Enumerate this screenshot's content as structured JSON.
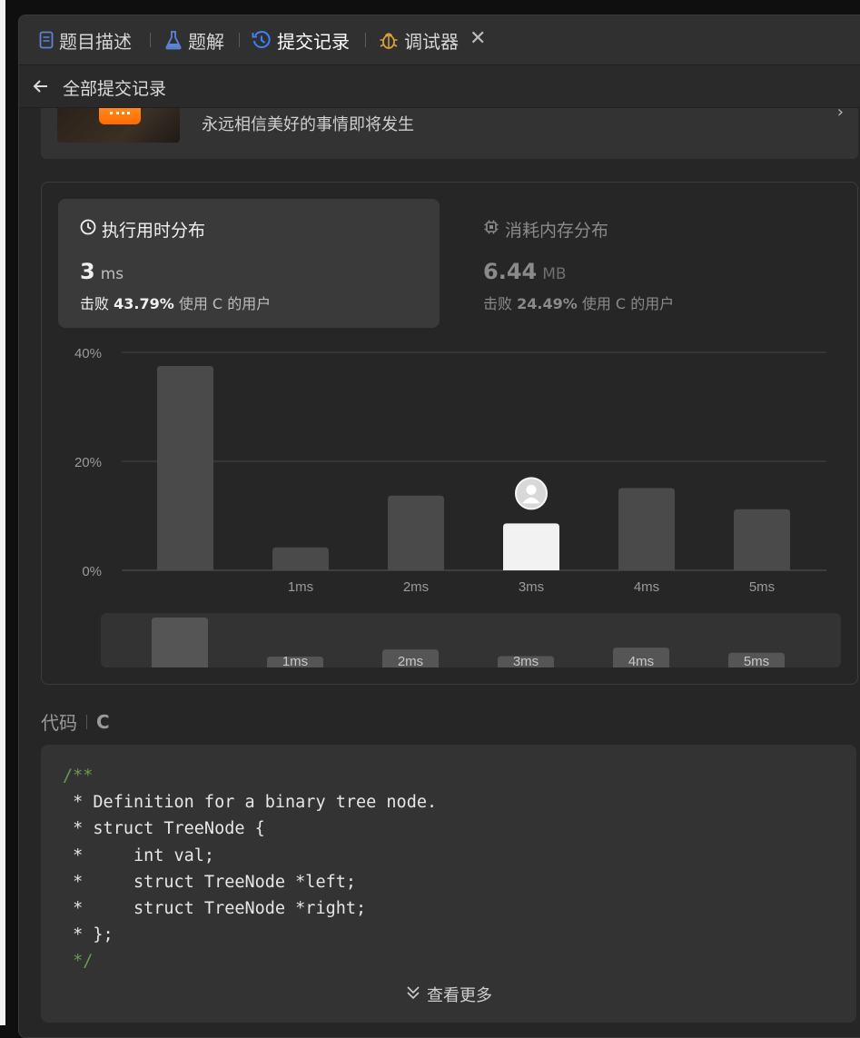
{
  "tabs": [
    {
      "label": "题目描述",
      "icon": "document-icon",
      "color": "#5b84d6"
    },
    {
      "label": "题解",
      "icon": "flask-icon",
      "color": "#5b84d6"
    },
    {
      "label": "提交记录",
      "icon": "history-icon",
      "color": "#3b82f6",
      "active": true
    },
    {
      "label": "调试器",
      "icon": "bug-icon",
      "color": "#d9a23a"
    }
  ],
  "close_icon": "close-icon",
  "back": {
    "label": "全部提交记录",
    "icon": "arrow-left-icon"
  },
  "banner": {
    "message": "永远相信美好的事情即将发生"
  },
  "stats": {
    "runtime": {
      "title": "执行用时分布",
      "value": "3",
      "unit": "ms",
      "beat_prefix": "击败",
      "beat_value": "43.79%",
      "beat_suffix": "使用 C 的用户"
    },
    "memory": {
      "title": "消耗内存分布",
      "value": "6.44",
      "unit": "MB",
      "beat_prefix": "击败",
      "beat_value": "24.49%",
      "beat_suffix": "使用 C 的用户"
    }
  },
  "chart_data": {
    "type": "bar",
    "categories": [
      "",
      "1ms",
      "2ms",
      "3ms",
      "4ms",
      "5ms"
    ],
    "values": [
      37.5,
      4.2,
      13.7,
      8.6,
      15.1,
      11.2
    ],
    "ylabel_ticks": [
      "0%",
      "20%",
      "40%"
    ],
    "ylim": [
      0,
      40
    ],
    "highlight_index": 3,
    "grid": true,
    "colors": {
      "bar": "#4a4a4a",
      "highlight": "#f2f2f2"
    },
    "overview": {
      "labels": [
        "",
        "1ms",
        "2ms",
        "3ms",
        "4ms",
        "5ms"
      ],
      "values": [
        37.5,
        4.2,
        13.7,
        8.6,
        15.1,
        11.2
      ]
    }
  },
  "code": {
    "label": "代码",
    "language": "C",
    "lines": [
      {
        "text": "/**",
        "comment": true
      },
      {
        "text": " * Definition for a binary tree node.",
        "comment": false
      },
      {
        "text": " * struct TreeNode {",
        "comment": false
      },
      {
        "text": " *     int val;",
        "comment": false
      },
      {
        "text": " *     struct TreeNode *left;",
        "comment": false
      },
      {
        "text": " *     struct TreeNode *right;",
        "comment": false
      },
      {
        "text": " * };",
        "comment": false
      },
      {
        "text": " */",
        "comment": true
      }
    ],
    "more_label": "查看更多"
  }
}
